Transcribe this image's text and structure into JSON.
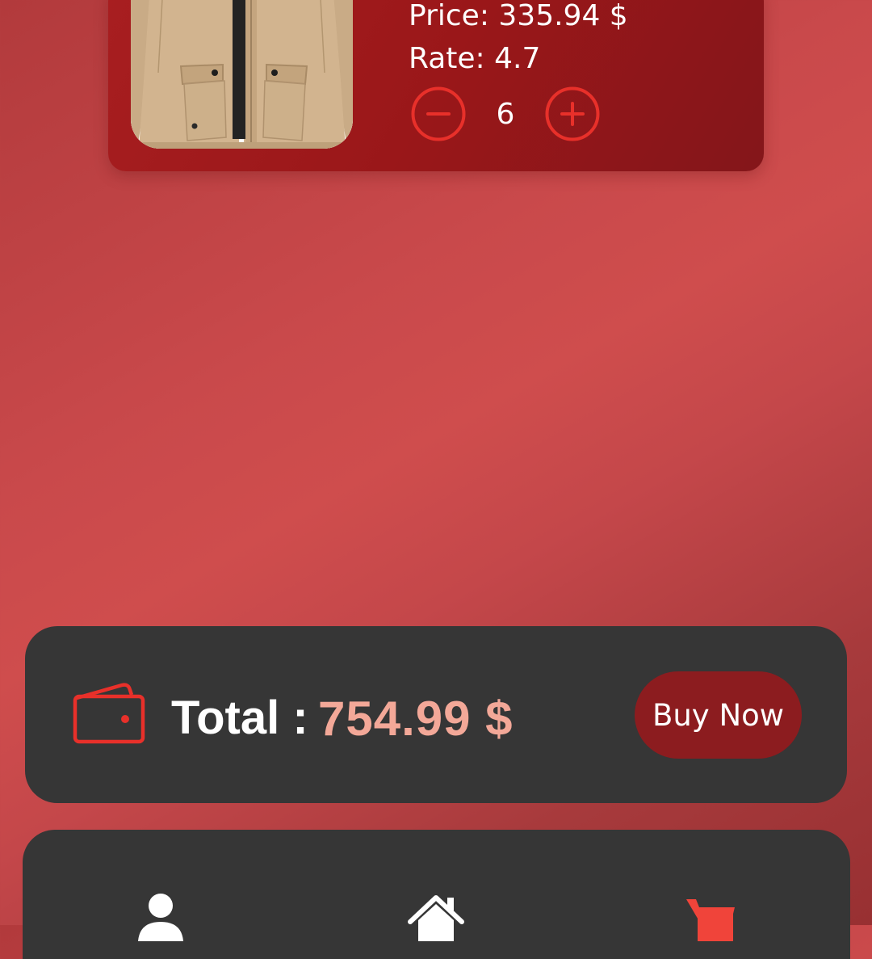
{
  "cart_item": {
    "image_alt": "Khaki jacket",
    "price_text": "Price: 335.94 $",
    "rate_text": "Rate: 4.7",
    "quantity": "6",
    "decrement_icon": "minus-circle-icon",
    "increment_icon": "plus-circle-icon"
  },
  "total_bar": {
    "icon": "wallet-icon",
    "label": "Total :",
    "value": "754.99 $",
    "buy_label": "Buy Now"
  },
  "bottom_nav": {
    "items": [
      {
        "icon": "person-icon",
        "active": false
      },
      {
        "icon": "home-icon",
        "active": false
      },
      {
        "icon": "cart-icon",
        "active": true
      }
    ]
  },
  "colors": {
    "accent_red": "#e8302a",
    "total_value": "#f3a898",
    "buy_button": "#8c1c1f",
    "panel_dark": "#363636",
    "card_red": "#9a1719"
  }
}
